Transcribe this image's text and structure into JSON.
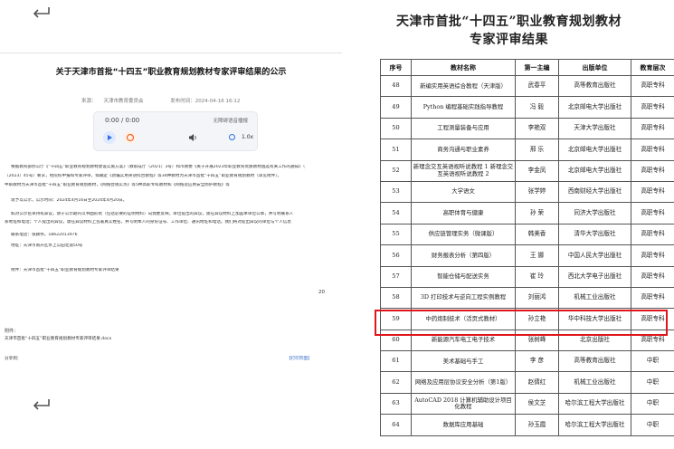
{
  "left": {
    "title": "关于天津市首批“十四五”职业教育规划教材专家评审结果的公示",
    "meta": {
      "source_label": "来源：",
      "source": "天津市教育委员会",
      "time_label": "发布时间：",
      "time": "2024-04-16 16:12"
    },
    "player": {
      "time": "0:00 / 0:00",
      "download": "无障碍语音播报",
      "speed": "1.0x",
      "icons": [
        "play-icon",
        "loop-icon",
        "volume-icon",
        "dot-icon"
      ]
    },
    "paragraphs": [
      "根据教育部办公厅《“十四五”职业教育规划教材建设实施方案》（教职成厅〔2021〕3号）和市教委《关于开展2023年职业教育优质教材遴选有关工作的通知》（",
      "〔2023〕45号）要求，经院校申报和专家评审，拟确定《新编实用英语综合教程》等34种教材为天津市首批“十四五”职业教育规划教材（详见附件）。",
      "中职教材为天津市首批“十四五”职业教育规划教材，《网络营销实务》等5种高职专科教材和《网络及应用安全防护教程》等",
      "现予以公示，公示时间：2024年4月16日至2024年4月20日。",
      "如对公示名单持有异议，请于公示期内以书面形式（包括必要的证明材料）向我委反映。单位提出的异议，需在异议材料上加盖本单位公章，并写明联系人",
      "系地址和电话；个人提出的异议，需在异议材料上签署真实姓名，并写明本人的身份证号、工作单位、通讯地址和电话。我们将对提出异议的单位与个人信息",
      "联系电话：张颖伟，18622013976",
      "地址：天津市南开区水上公园北道50号",
      "附件：天津市首批“十四五”职业教育规划教材专家评审结果"
    ],
    "page_number": "20",
    "attachment_label": "附件：",
    "attachment_file": "天津市首批“十四五”职业教育规划教材专家评审结果.docx",
    "share_label": "分享到：",
    "print_link": "【打印页面】"
  },
  "right": {
    "title_line1": "天津市首批“十四五”职业教育规划教材",
    "title_line2": "专家评审结果",
    "headers": [
      "序号",
      "教材名称",
      "第一主编",
      "出版单位",
      "教育层次"
    ],
    "rows": [
      {
        "no": "48",
        "name": "新编实用英语综合教程（天津版）",
        "editor": "武春平",
        "publisher": "高等教育出版社",
        "level": "高职专科"
      },
      {
        "no": "49",
        "name": "Python 编程基础实践指导教程",
        "editor": "冯 毅",
        "publisher": "北京邮电大学出版社",
        "level": "高职专科"
      },
      {
        "no": "50",
        "name": "工程测量装备与应用",
        "editor": "李艳双",
        "publisher": "天津大学出版社",
        "level": "高职专科"
      },
      {
        "no": "51",
        "name": "商务沟通与职业素养",
        "editor": "邢 乐",
        "publisher": "北京邮电大学出版社",
        "level": "高职专科"
      },
      {
        "no": "52",
        "name": "新理念交互英语视听说教程 1 新理念交互英语视听说教程 2",
        "editor": "李金凤",
        "publisher": "北京邮电大学出版社",
        "level": "高职专科"
      },
      {
        "no": "53",
        "name": "大学语文",
        "editor": "张学婷",
        "publisher": "西南财经大学出版社",
        "level": "高职专科"
      },
      {
        "no": "54",
        "name": "高职体育与健康",
        "editor": "孙 荣",
        "publisher": "同济大学出版社",
        "level": "高职专科"
      },
      {
        "no": "55",
        "name": "供应链管理实务（微课版）",
        "editor": "韩美香",
        "publisher": "清华大学出版社",
        "level": "高职专科"
      },
      {
        "no": "56",
        "name": "财务报表分析（第四版）",
        "editor": "王 娜",
        "publisher": "中国人民大学出版社",
        "level": "高职专科"
      },
      {
        "no": "57",
        "name": "智能仓储与配送实务",
        "editor": "崔 玲",
        "publisher": "西北大学电子出版社",
        "level": "高职专科"
      },
      {
        "no": "58",
        "name": "3D 打印技术与逆向工程实例教程",
        "editor": "刘丽鸿",
        "publisher": "机械工业出版社",
        "level": "高职专科"
      },
      {
        "no": "59",
        "name": "中药炮制技术（活页式教材）",
        "editor": "孙立艳",
        "publisher": "华中科技大学出版社",
        "level": "高职专科"
      },
      {
        "no": "60",
        "name": "新能源汽车电工电子技术",
        "editor": "张树峰",
        "publisher": "北京出版社",
        "level": "高职专科"
      },
      {
        "no": "61",
        "name": "美术基础与手工",
        "editor": "李 彦",
        "publisher": "高等教育出版社",
        "level": "中职"
      },
      {
        "no": "62",
        "name": "网络及应用层协议安全分析（第1版）",
        "editor": "赵倩红",
        "publisher": "机械工业出版社",
        "level": "中职"
      },
      {
        "no": "63",
        "name": "AutoCAD 2018 计算机辅助设计项目化教程",
        "editor": "侯文芝",
        "publisher": "哈尔滨工程大学出版社",
        "level": "中职"
      },
      {
        "no": "64",
        "name": "数据库应用基础",
        "editor": "孙玉霞",
        "publisher": "哈尔滨工程大学出版社",
        "level": "中职"
      }
    ],
    "highlight_color": "#e0151b"
  }
}
